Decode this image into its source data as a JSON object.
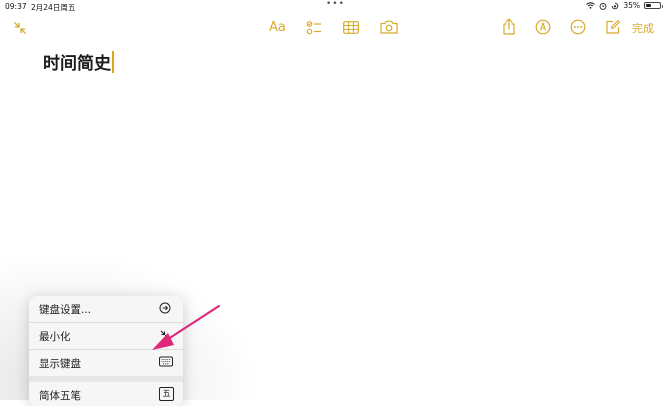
{
  "status_bar": {
    "time": "09:37",
    "date": "2月24日周五",
    "battery_percent": "35%",
    "battery_level": 0.35
  },
  "toolbar": {
    "format_label": "Aa",
    "done_label": "完成"
  },
  "note": {
    "title": "时间简史"
  },
  "keyboard_menu": {
    "items": [
      {
        "label": "键盘设置...",
        "icon": "keyboard-settings-icon"
      },
      {
        "label": "最小化",
        "icon": "minimize-icon"
      },
      {
        "label": "显示键盘",
        "icon": "keyboard-icon"
      },
      {
        "label": "简体五笔",
        "icon": "wubi-icon",
        "icon_text": "五"
      }
    ]
  },
  "colors": {
    "accent": "#d8a92b",
    "annotation": "#e0287a",
    "menu_bg": "#f6f6f7"
  }
}
